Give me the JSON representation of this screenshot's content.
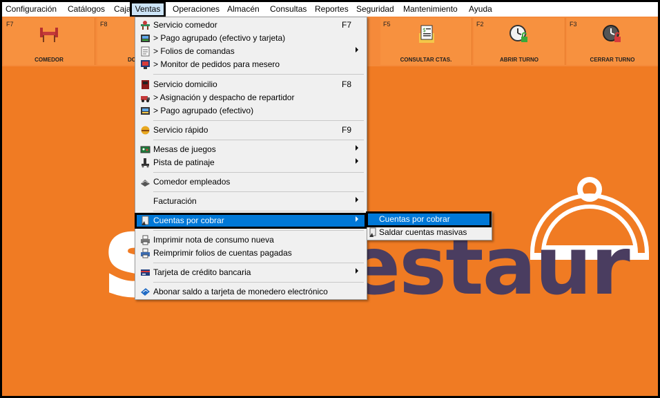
{
  "menubar": {
    "items": [
      {
        "label": "Configuración"
      },
      {
        "label": "Catálogos"
      },
      {
        "label": "Caja"
      },
      {
        "label": "Ventas"
      },
      {
        "label": "Operaciones"
      },
      {
        "label": "Almacén"
      },
      {
        "label": "Consultas"
      },
      {
        "label": "Reportes"
      },
      {
        "label": "Seguridad"
      },
      {
        "label": "Mantenimiento"
      },
      {
        "label": "Ayuda"
      }
    ]
  },
  "toolbar": {
    "buttons": [
      {
        "key": "F7",
        "label": "COMEDOR",
        "icon": "dining-table-icon"
      },
      {
        "key": "F8",
        "label": "DO",
        "icon": "delivery-icon"
      },
      {
        "key": "F5",
        "label": "CONSULTAR CTAS.",
        "icon": "account-document-icon"
      },
      {
        "key": "F2",
        "label": "ABRIR  TURNO",
        "icon": "clock-open-icon"
      },
      {
        "key": "F3",
        "label": "CERRAR TURNO",
        "icon": "clock-close-icon"
      }
    ]
  },
  "background": {
    "logo_text_left": "Soft",
    "logo_text_right": "Restaur"
  },
  "ventas_menu": {
    "items": [
      {
        "label": "Servicio comedor",
        "shortcut": "F7",
        "icon": "dining-icon"
      },
      {
        "label": "> Pago agrupado (efectivo y tarjeta)",
        "icon": "payment-icon"
      },
      {
        "label": "> Folios de comandas",
        "icon": "folio-icon",
        "submenu": true
      },
      {
        "label": "> Monitor de pedidos para mesero",
        "icon": "monitor-icon"
      },
      {
        "label": "Servicio domicilio",
        "shortcut": "F8",
        "icon": "home-delivery-icon"
      },
      {
        "label": "> Asignación y despacho de repartidor",
        "icon": "dispatch-icon"
      },
      {
        "label": "> Pago agrupado (efectivo)",
        "icon": "cash-payment-icon"
      },
      {
        "label": "Servicio rápido",
        "shortcut": "F9",
        "icon": "fast-service-icon"
      },
      {
        "label": "Mesas de juegos",
        "icon": "game-table-icon",
        "submenu": true
      },
      {
        "label": "Pista de patinaje",
        "icon": "skate-icon",
        "submenu": true
      },
      {
        "label": "Comedor empleados",
        "icon": "employee-dining-icon"
      },
      {
        "label": "Facturación",
        "submenu": true
      },
      {
        "label": "Cuentas por cobrar",
        "icon": "receivables-icon",
        "submenu": true
      },
      {
        "label": "Imprimir nota de consumo nueva",
        "icon": "printer-icon"
      },
      {
        "label": "Reimprimir folios de cuentas pagadas",
        "icon": "reprint-icon"
      },
      {
        "label": "Tarjeta de crédito bancaria",
        "icon": "credit-card-icon",
        "submenu": true
      },
      {
        "label": "Abonar saldo a tarjeta de monedero electrónico",
        "icon": "wallet-card-icon"
      }
    ]
  },
  "cuentas_submenu": {
    "items": [
      {
        "label": "Cuentas por cobrar"
      },
      {
        "label": "Saldar cuentas masivas"
      }
    ]
  },
  "colors": {
    "accent": "#0078d7",
    "background": "#f07b23",
    "logo": "#4a3d60"
  }
}
